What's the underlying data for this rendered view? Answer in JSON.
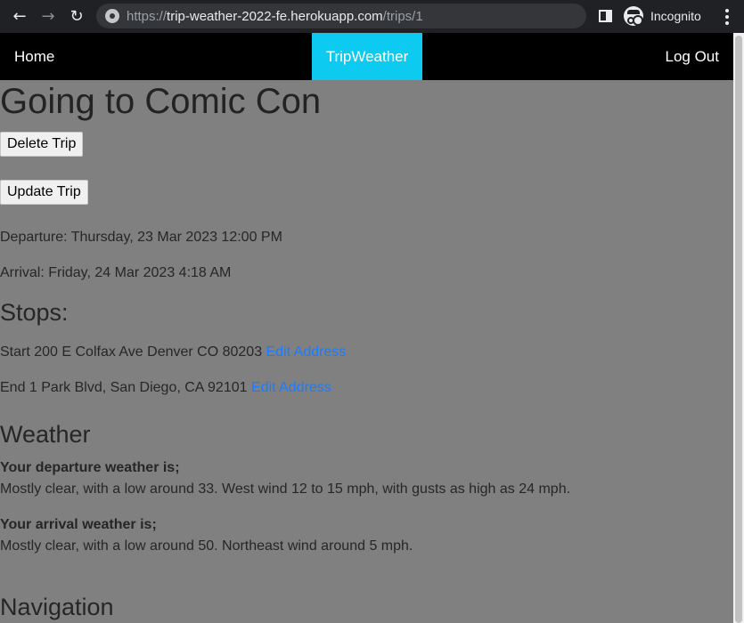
{
  "browser": {
    "url_scheme": "https://",
    "url_host": "trip-weather-2022-fe.herokuapp.com",
    "url_path": "/trips/1",
    "profile_label": "Incognito"
  },
  "nav": {
    "home": "Home",
    "brand": "TripWeather",
    "logout": "Log Out"
  },
  "trip": {
    "title": "Going to Comic Con",
    "delete_label": "Delete Trip",
    "update_label": "Update Trip",
    "departure": "Departure: Thursday, 23 Mar 2023 12:00 PM",
    "arrival": "Arrival: Friday, 24 Mar 2023 4:18 AM"
  },
  "stops": {
    "heading": "Stops:",
    "start_text": "Start 200 E Colfax Ave Denver CO 80203",
    "start_link": "Edit Address",
    "end_text": "End 1 Park Blvd, San Diego, CA 92101",
    "end_link": "Edit Address"
  },
  "weather": {
    "heading": "Weather",
    "departure_label": "Your departure weather is;",
    "departure_forecast": "Mostly clear, with a low around 33. West wind 12 to 15 mph, with gusts as high as 24 mph.",
    "arrival_label": "Your arrival weather is;",
    "arrival_forecast": "Mostly clear, with a low around 50. Northeast wind around 5 mph."
  },
  "navigation": {
    "heading": "Navigation"
  },
  "colors": {
    "page_bg": "#808080",
    "nav_bg": "#000000",
    "brand_bg": "#0dcaf0",
    "link": "#1a7cff"
  }
}
